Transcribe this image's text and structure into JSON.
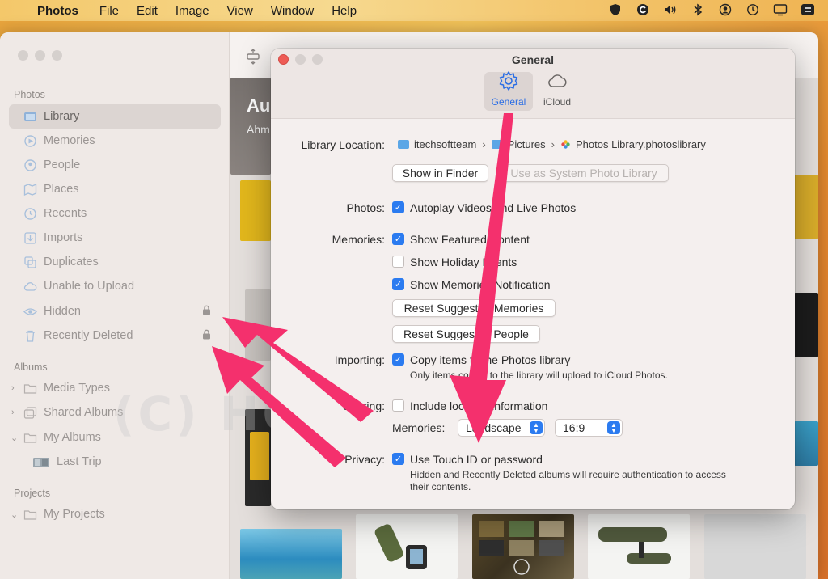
{
  "menubar": {
    "app": "Photos",
    "items": [
      "File",
      "Edit",
      "Image",
      "View",
      "Window",
      "Help"
    ]
  },
  "sidebar": {
    "photos_section": "Photos",
    "items": [
      {
        "label": "Library",
        "icon": "library-icon",
        "active": true
      },
      {
        "label": "Memories",
        "icon": "memories-icon"
      },
      {
        "label": "People",
        "icon": "people-icon"
      },
      {
        "label": "Places",
        "icon": "places-icon"
      },
      {
        "label": "Recents",
        "icon": "recents-icon"
      },
      {
        "label": "Imports",
        "icon": "imports-icon"
      },
      {
        "label": "Duplicates",
        "icon": "duplicates-icon"
      },
      {
        "label": "Unable to Upload",
        "icon": "cloud-icon"
      },
      {
        "label": "Hidden",
        "icon": "eye-icon",
        "locked": true
      },
      {
        "label": "Recently Deleted",
        "icon": "trash-icon",
        "locked": true
      }
    ],
    "albums_section": "Albums",
    "albums": [
      {
        "label": "Media Types",
        "icon": "folder-icon"
      },
      {
        "label": "Shared Albums",
        "icon": "shared-albums-icon"
      },
      {
        "label": "My Albums",
        "icon": "folder-icon"
      },
      {
        "label": "Last Trip",
        "icon": "album-thumbnail-icon"
      }
    ],
    "projects_section": "Projects",
    "projects": [
      {
        "label": "My Projects",
        "icon": "folder-icon"
      }
    ]
  },
  "background": {
    "title_partial": "Au",
    "subtitle_partial": "Ahm"
  },
  "dialog": {
    "title": "General",
    "tabs": [
      {
        "label": "General",
        "icon": "gear-icon",
        "active": true
      },
      {
        "label": "iCloud",
        "icon": "cloud-icon"
      }
    ],
    "library_location": {
      "label": "Library Location:",
      "path": [
        "itechsoftteam",
        "Pictures",
        "Photos Library.photoslibrary"
      ],
      "show_in_finder": "Show in Finder",
      "use_system": "Use as System Photo Library"
    },
    "photos": {
      "label": "Photos:",
      "autoplay": "Autoplay Videos and Live Photos"
    },
    "memories": {
      "label": "Memories:",
      "featured": "Show Featured Content",
      "holiday": "Show Holiday Events",
      "notification": "Show Memories Notification",
      "reset_memories": "Reset Suggested Memories",
      "reset_people": "Reset Suggested People"
    },
    "importing": {
      "label": "Importing:",
      "copy": "Copy items to the Photos library",
      "note": "Only items copied to the library will upload to iCloud Photos."
    },
    "sharing": {
      "label": "Sharing:",
      "location": "Include location information",
      "memories_label": "Memories:",
      "orientation": "Landscape",
      "aspect": "16:9"
    },
    "privacy": {
      "label": "Privacy:",
      "touch_id": "Use Touch ID or password",
      "note_line1": "Hidden and Recently Deleted albums will require authentication to access",
      "note_line2": "their contents."
    }
  },
  "watermark": "(C) HOWTOISOLVE.COM",
  "colors": {
    "accent": "#2b7bf0",
    "arrow": "#f4306d"
  }
}
